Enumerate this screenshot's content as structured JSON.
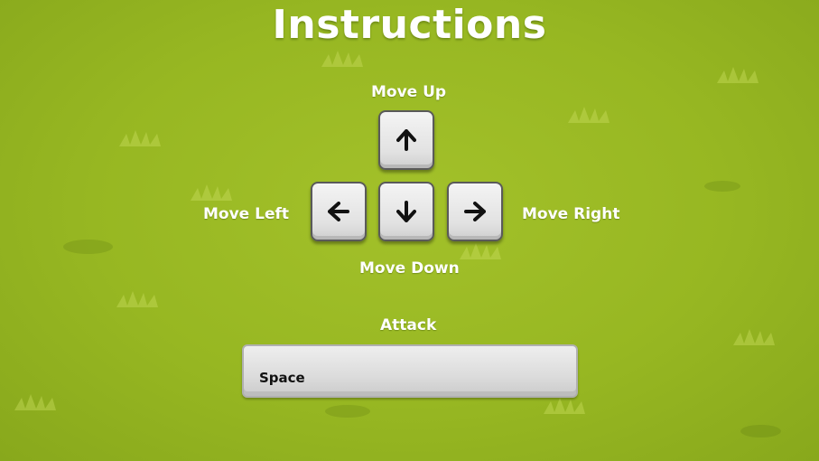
{
  "title": "Instructions",
  "controls": {
    "up": {
      "label": "Move Up",
      "icon": "arrow-up-icon"
    },
    "left": {
      "label": "Move Left",
      "icon": "arrow-left-icon"
    },
    "down": {
      "label": "Move Down",
      "icon": "arrow-down-icon"
    },
    "right": {
      "label": "Move Right",
      "icon": "arrow-right-icon"
    }
  },
  "attack": {
    "label": "Attack",
    "key": "Space"
  },
  "colors": {
    "background": "#97b722",
    "text": "#ffffff",
    "key_face": "#e6e6e6",
    "key_border": "#5a5a5a"
  }
}
